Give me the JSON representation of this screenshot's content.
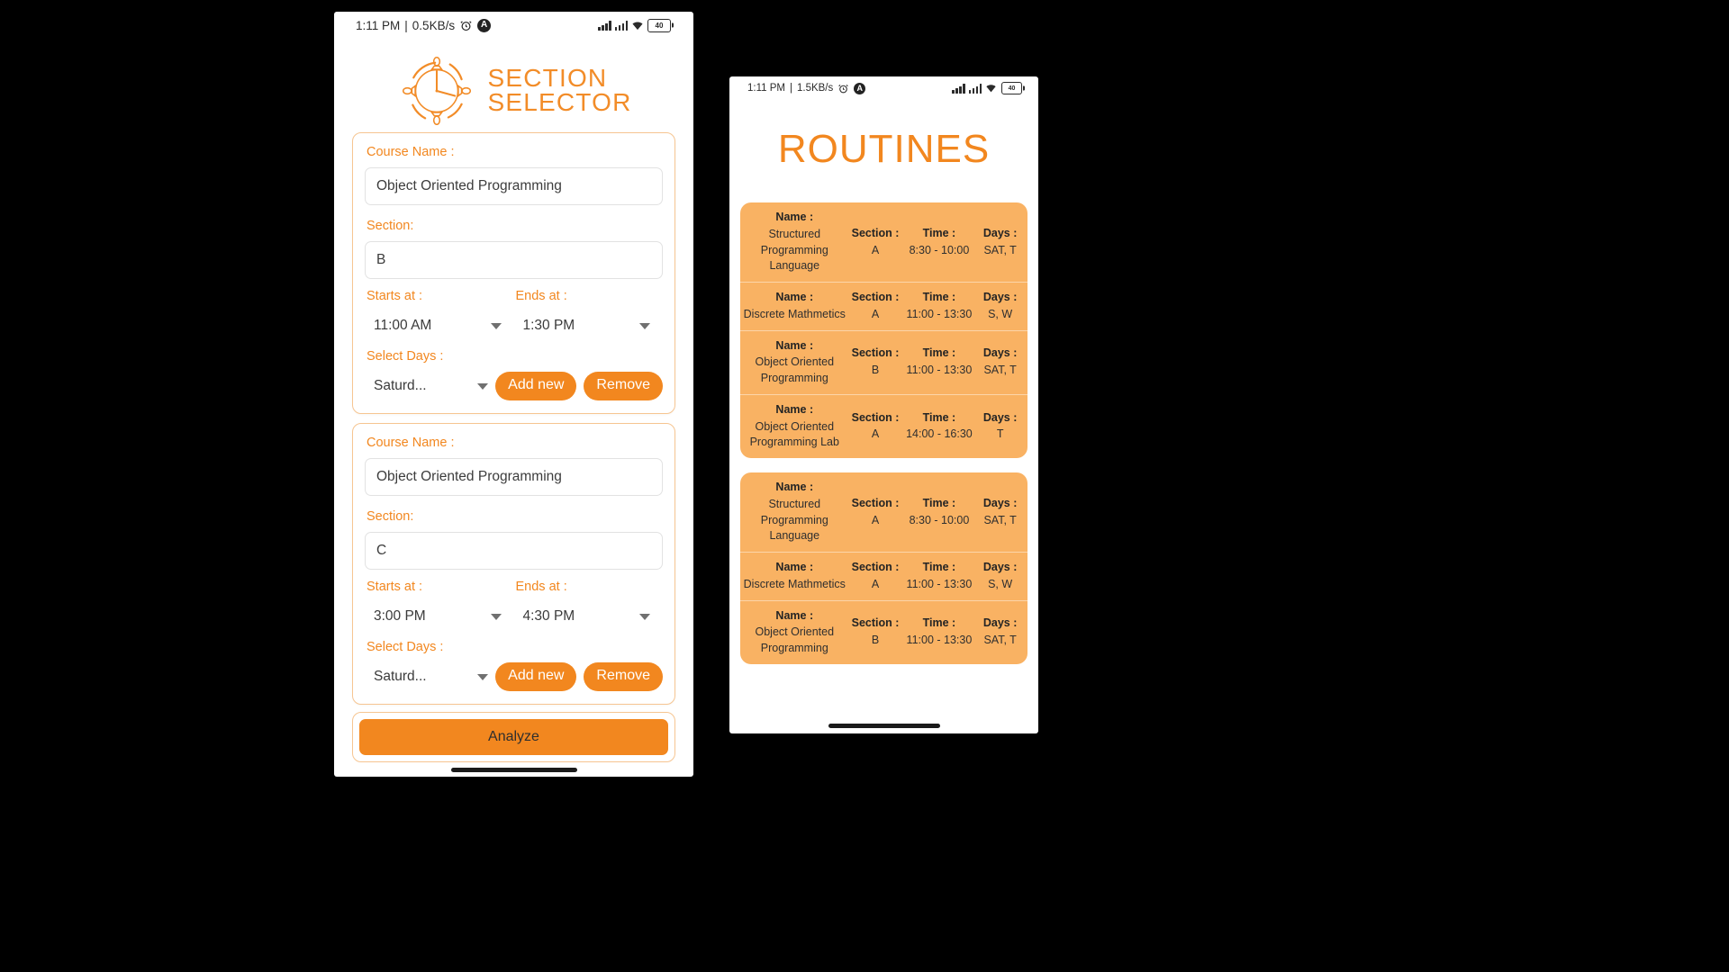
{
  "phone_left": {
    "status_bar": {
      "time": "1:11 PM",
      "separator": "|",
      "network_speed": "0.5KB/s",
      "alarm_icon": "alarm-clock-icon",
      "app_badge": "A",
      "battery_level": "40"
    },
    "logo": {
      "icon": "clock-compass-logo",
      "line1": "SECTION",
      "line2": "SELECTOR",
      "color": "#f28c28"
    },
    "labels": {
      "course_name": "Course Name :",
      "section": "Section:",
      "starts_at": "Starts at :",
      "ends_at": "Ends at :",
      "select_days": "Select Days :"
    },
    "buttons": {
      "add_new": "Add new",
      "remove": "Remove",
      "analyze": "Analyze"
    },
    "courses": [
      {
        "course_name": "Object Oriented Programming",
        "section": "B",
        "starts_at": "11:00 AM",
        "ends_at": "1:30 PM",
        "days": "Saturd..."
      },
      {
        "course_name": "Object Oriented Programming",
        "section": "C",
        "starts_at": "3:00 PM",
        "ends_at": "4:30 PM",
        "days": "Saturd..."
      }
    ]
  },
  "phone_right": {
    "status_bar": {
      "time": "1:11 PM",
      "separator": "|",
      "network_speed": "1.5KB/s",
      "alarm_icon": "alarm-clock-icon",
      "app_badge": "A",
      "battery_level": "40"
    },
    "title": "ROUTINES",
    "headers": {
      "name": "Name :",
      "section": "Section :",
      "time": "Time :",
      "days": "Days :"
    },
    "cards": [
      {
        "rows": [
          {
            "name": "Structured Programming Language",
            "section": "A",
            "time": "8:30 - 10:00",
            "days": "SAT, T"
          },
          {
            "name": "Discrete Mathmetics",
            "section": "A",
            "time": "11:00 - 13:30",
            "days": "S, W"
          },
          {
            "name": "Object Oriented Programming",
            "section": "B",
            "time": "11:00 - 13:30",
            "days": "SAT, T"
          },
          {
            "name": "Object Oriented Programming Lab",
            "section": "A",
            "time": "14:00 - 16:30",
            "days": "T"
          }
        ]
      },
      {
        "rows": [
          {
            "name": "Structured Programming Language",
            "section": "A",
            "time": "8:30 - 10:00",
            "days": "SAT, T"
          },
          {
            "name": "Discrete Mathmetics",
            "section": "A",
            "time": "11:00 - 13:30",
            "days": "S, W"
          },
          {
            "name": "Object Oriented Programming",
            "section": "B",
            "time": "11:00 - 13:30",
            "days": "SAT, T"
          }
        ]
      }
    ]
  },
  "theme": {
    "accent": "#f2871f",
    "card_orange": "#f9b263",
    "border_orange": "#f6c591"
  }
}
